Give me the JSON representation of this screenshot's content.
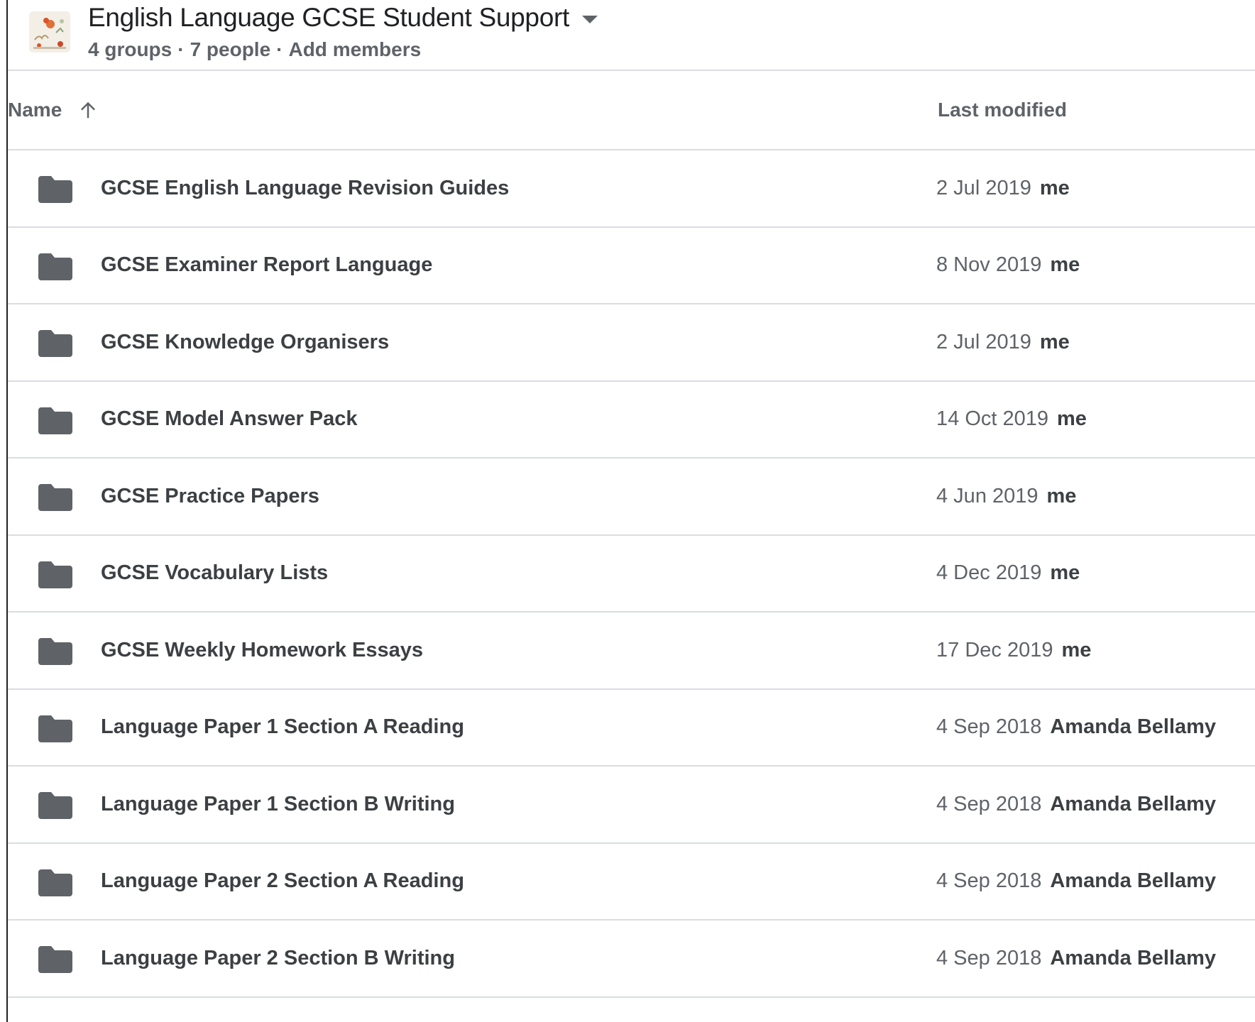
{
  "header": {
    "title": "English Language GCSE Student Support",
    "groups": "4 groups",
    "people": "7 people",
    "separator": "·",
    "add_members": "Add members",
    "avatar_icon": "shared-drive-thumbnail-icon",
    "caret_icon": "dropdown-caret-icon"
  },
  "columns": {
    "name": "Name",
    "sort_icon": "arrow-up-icon",
    "last_modified": "Last modified"
  },
  "folder_color": "#5f6368",
  "rows": [
    {
      "name": "GCSE English Language Revision Guides",
      "date": "2 Jul 2019",
      "by": "me"
    },
    {
      "name": "GCSE Examiner Report Language",
      "date": "8 Nov 2019",
      "by": "me"
    },
    {
      "name": "GCSE Knowledge Organisers",
      "date": "2 Jul 2019",
      "by": "me"
    },
    {
      "name": "GCSE Model Answer Pack",
      "date": "14 Oct 2019",
      "by": "me"
    },
    {
      "name": "GCSE Practice Papers",
      "date": "4 Jun 2019",
      "by": "me"
    },
    {
      "name": "GCSE Vocabulary Lists",
      "date": "4 Dec 2019",
      "by": "me"
    },
    {
      "name": "GCSE Weekly Homework Essays",
      "date": "17 Dec 2019",
      "by": "me"
    },
    {
      "name": "Language Paper 1 Section A Reading",
      "date": "4 Sep 2018",
      "by": "Amanda Bellamy"
    },
    {
      "name": "Language Paper 1 Section B Writing",
      "date": "4 Sep 2018",
      "by": "Amanda Bellamy"
    },
    {
      "name": "Language Paper 2 Section A Reading",
      "date": "4 Sep 2018",
      "by": "Amanda Bellamy"
    },
    {
      "name": "Language Paper 2 Section B Writing",
      "date": "4 Sep 2018",
      "by": "Amanda Bellamy"
    }
  ]
}
